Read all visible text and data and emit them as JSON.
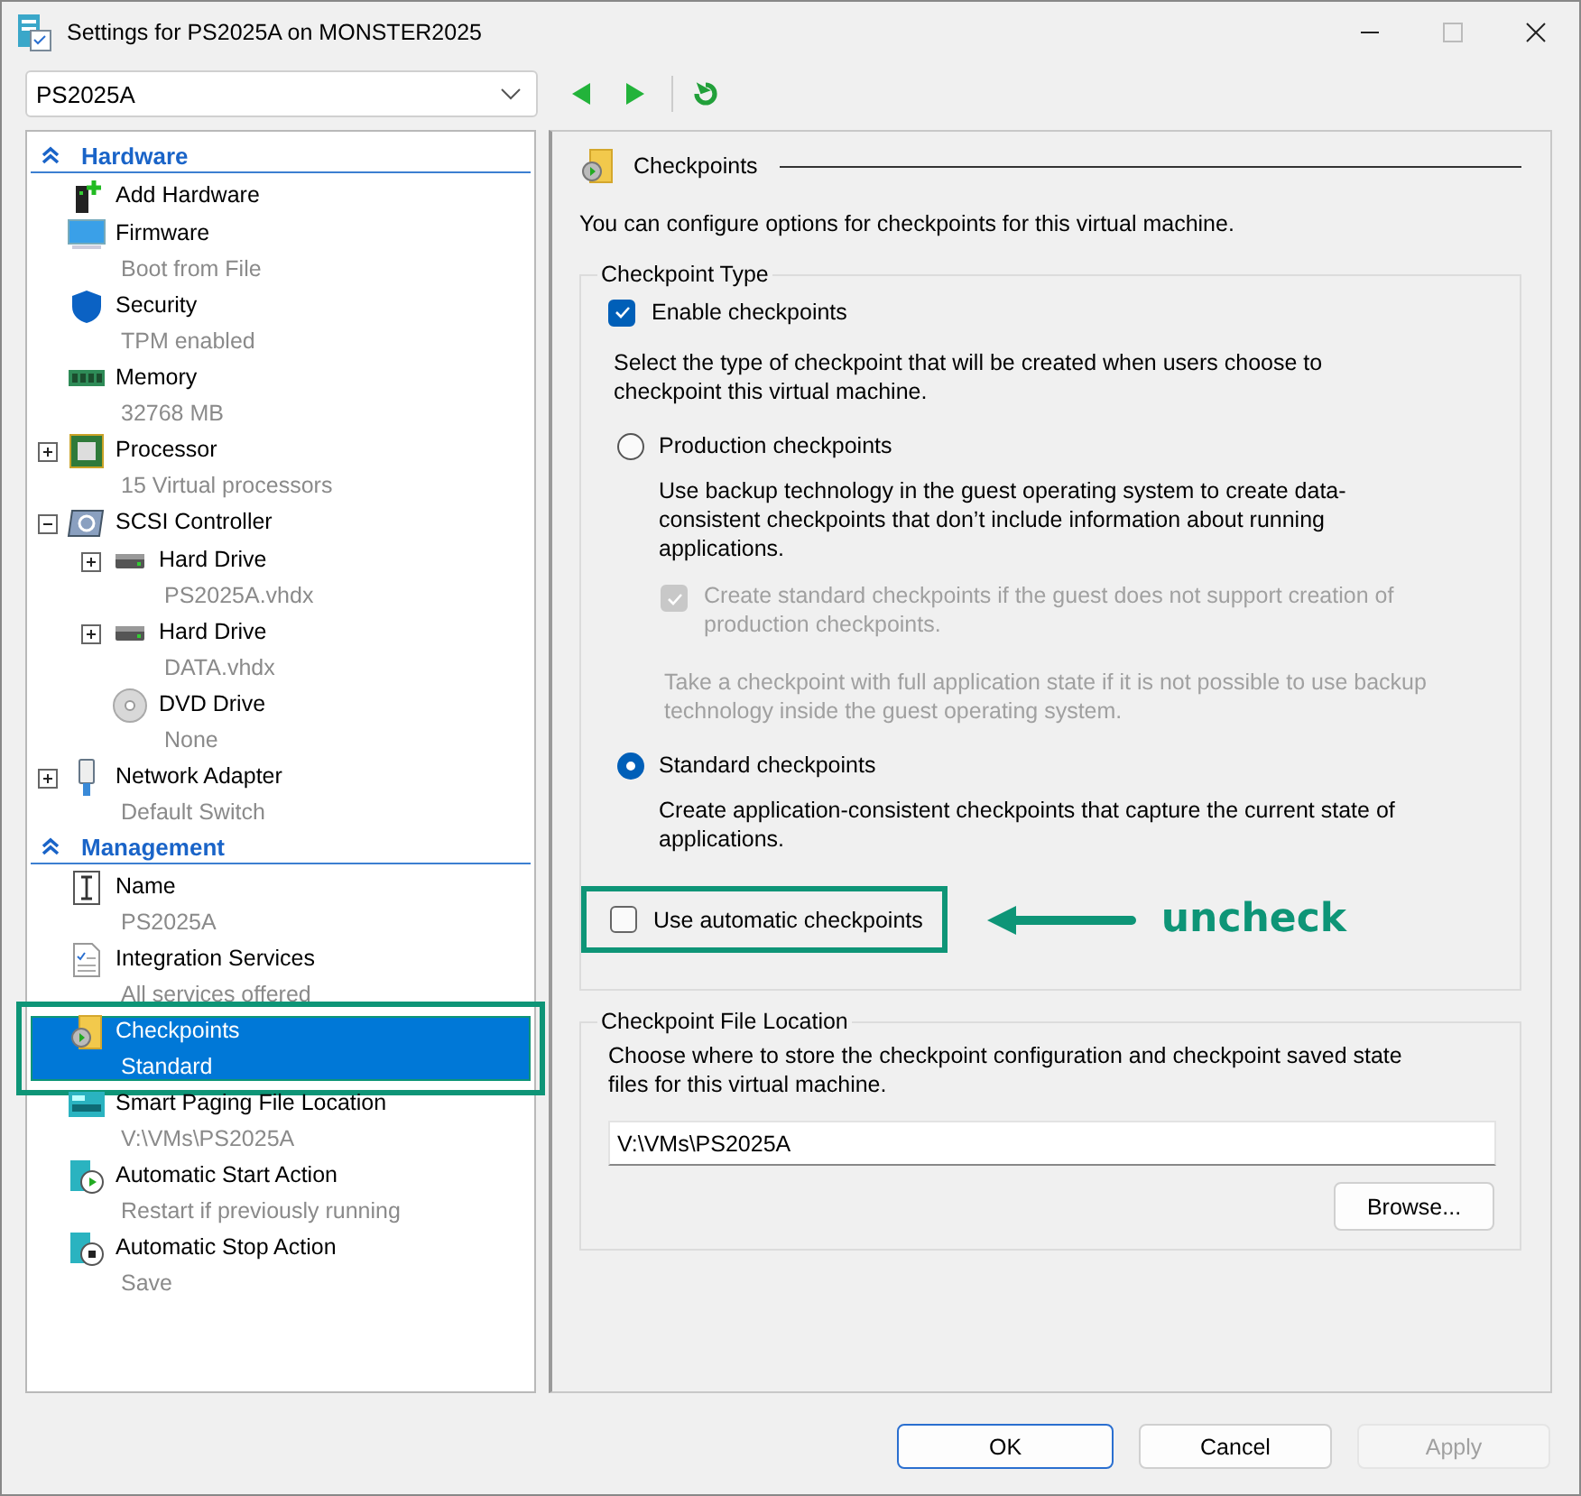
{
  "window": {
    "title": "Settings for PS2025A on MONSTER2025"
  },
  "vm_selector": {
    "value": "PS2025A"
  },
  "sidebar": {
    "sections": [
      {
        "title": "Hardware",
        "expanded": true,
        "items": [
          {
            "kind": "hardware",
            "name": "Add Hardware",
            "selected": false,
            "highlighted": false
          },
          {
            "kind": "firmware",
            "name": "Firmware",
            "detail": "Boot from File",
            "selected": false,
            "highlighted": false
          },
          {
            "kind": "security",
            "name": "Security",
            "detail": "TPM enabled",
            "selected": false,
            "highlighted": false
          },
          {
            "kind": "memory",
            "name": "Memory",
            "detail": "32768 MB",
            "selected": false,
            "highlighted": false
          },
          {
            "kind": "processor",
            "name": "Processor",
            "detail": "15 Virtual processors",
            "expanded": false,
            "selected": false,
            "highlighted": false
          },
          {
            "kind": "controller",
            "name": "SCSI Controller",
            "expanded": true,
            "selected": false,
            "highlighted": false,
            "children": [
              {
                "kind": "disk",
                "name": "Hard Drive",
                "detail": "PS2025A.vhdx",
                "expanded": false,
                "selected": false,
                "highlighted": false
              },
              {
                "kind": "disk",
                "name": "Hard Drive",
                "detail": "DATA.vhdx",
                "expanded": false,
                "selected": false,
                "highlighted": false
              },
              {
                "kind": "dvd",
                "name": "DVD Drive",
                "detail": "None",
                "selected": false,
                "highlighted": false
              }
            ]
          },
          {
            "kind": "network",
            "name": "Network Adapter",
            "detail": "Default Switch",
            "expanded": false,
            "selected": false,
            "highlighted": false
          }
        ]
      },
      {
        "title": "Management",
        "expanded": true,
        "items": [
          {
            "kind": "name",
            "name": "Name",
            "detail": "PS2025A",
            "selected": false,
            "highlighted": false
          },
          {
            "kind": "integration",
            "name": "Integration Services",
            "detail": "All services offered",
            "selected": false,
            "highlighted": false
          },
          {
            "kind": "checkpoints",
            "name": "Checkpoints",
            "detail": "Standard",
            "selected": true,
            "highlighted": true
          },
          {
            "kind": "paging",
            "name": "Smart Paging File Location",
            "detail": "V:\\VMs\\PS2025A",
            "selected": false,
            "highlighted": false
          },
          {
            "kind": "start",
            "name": "Automatic Start Action",
            "detail": "Restart if previously running",
            "selected": false,
            "highlighted": false
          },
          {
            "kind": "stop",
            "name": "Automatic Stop Action",
            "detail": "Save",
            "selected": false,
            "highlighted": false
          }
        ]
      }
    ]
  },
  "checkpoints_page": {
    "heading": "Checkpoints",
    "intro": "You can configure options for checkpoints for this virtual machine.",
    "type_group": {
      "title": "Checkpoint Type",
      "enable": {
        "label": "Enable checkpoints",
        "checked": true
      },
      "description": "Select the type of checkpoint that will be created when users choose to checkpoint this virtual machine.",
      "options": [
        {
          "label": "Production checkpoints",
          "selected": false,
          "description": "Use backup technology in the guest operating system to create data-consistent checkpoints that don’t include information about running applications.",
          "fallback": {
            "label": "Create standard checkpoints if the guest does not support creation of production checkpoints.",
            "checked": true,
            "disabled": true,
            "note": "Take a checkpoint with full application state if it is not possible to use backup technology inside the guest operating system."
          }
        },
        {
          "label": "Standard checkpoints",
          "selected": true,
          "description": "Create application-consistent checkpoints that capture the current state of applications."
        }
      ],
      "automatic": {
        "label": "Use automatic checkpoints",
        "checked": false,
        "highlighted": true
      }
    },
    "location_group": {
      "title": "Checkpoint File Location",
      "description": "Choose where to store the checkpoint configuration and checkpoint saved state files for this virtual machine.",
      "path": "V:\\VMs\\PS2025A",
      "browse": "Browse..."
    }
  },
  "annotation": {
    "text": "uncheck"
  },
  "buttons": [
    {
      "label": "OK",
      "default": true,
      "disabled": false
    },
    {
      "label": "Cancel",
      "default": false,
      "disabled": false
    },
    {
      "label": "Apply",
      "default": false,
      "disabled": true
    }
  ]
}
